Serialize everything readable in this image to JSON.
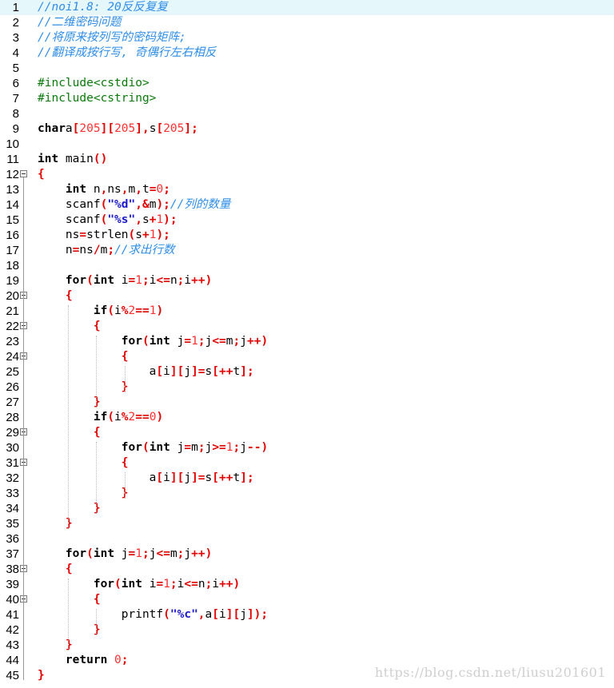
{
  "editor": {
    "lines": [
      {
        "n": "1",
        "active": true,
        "segs": [
          [
            "cmt",
            "//noi1.8: 20反反复复"
          ]
        ]
      },
      {
        "n": "2",
        "segs": [
          [
            "cmt",
            "//二维密码问题"
          ]
        ]
      },
      {
        "n": "3",
        "segs": [
          [
            "cmt",
            "//将原来按列写的密码矩阵;"
          ]
        ]
      },
      {
        "n": "4",
        "segs": [
          [
            "cmt",
            "//翻译成按行写, 奇偶行左右相反"
          ]
        ]
      },
      {
        "n": "5",
        "segs": []
      },
      {
        "n": "6",
        "segs": [
          [
            "pp",
            "#include<cstdio>"
          ]
        ]
      },
      {
        "n": "7",
        "segs": [
          [
            "pp",
            "#include<cstring>"
          ]
        ]
      },
      {
        "n": "8",
        "segs": []
      },
      {
        "n": "9",
        "segs": [
          [
            "kw",
            "char"
          ],
          [
            "",
            "a"
          ],
          [
            "op",
            "["
          ],
          [
            "num",
            "205"
          ],
          [
            "op",
            "]["
          ],
          [
            "num",
            "205"
          ],
          [
            "op",
            "],"
          ],
          [
            "",
            "s"
          ],
          [
            "op",
            "["
          ],
          [
            "num",
            "205"
          ],
          [
            "op",
            "];"
          ]
        ]
      },
      {
        "n": "10",
        "segs": []
      },
      {
        "n": "11",
        "segs": [
          [
            "kw",
            "int"
          ],
          [
            "",
            " main"
          ],
          [
            "op",
            "()"
          ]
        ]
      },
      {
        "n": "12",
        "fold": true,
        "segs": [
          [
            "op",
            "{"
          ]
        ]
      },
      {
        "n": "13",
        "segs": [
          [
            "",
            "    "
          ],
          [
            "kw",
            "int"
          ],
          [
            "",
            " n"
          ],
          [
            "op",
            ","
          ],
          [
            "",
            "ns"
          ],
          [
            "op",
            ","
          ],
          [
            "",
            "m"
          ],
          [
            "op",
            ","
          ],
          [
            "",
            "t"
          ],
          [
            "op",
            "="
          ],
          [
            "num",
            "0"
          ],
          [
            "op",
            ";"
          ]
        ]
      },
      {
        "n": "14",
        "segs": [
          [
            "",
            "    scanf"
          ],
          [
            "op",
            "("
          ],
          [
            "str",
            "\"%d\""
          ],
          [
            "op",
            ",&"
          ],
          [
            "",
            "m"
          ],
          [
            "op",
            ");"
          ],
          [
            "cmt",
            "//列的数量"
          ]
        ]
      },
      {
        "n": "15",
        "segs": [
          [
            "",
            "    scanf"
          ],
          [
            "op",
            "("
          ],
          [
            "str",
            "\"%s\""
          ],
          [
            "op",
            ","
          ],
          [
            "",
            "s"
          ],
          [
            "op",
            "+"
          ],
          [
            "num",
            "1"
          ],
          [
            "op",
            ");"
          ]
        ]
      },
      {
        "n": "16",
        "segs": [
          [
            "",
            "    ns"
          ],
          [
            "op",
            "="
          ],
          [
            "",
            "strlen"
          ],
          [
            "op",
            "("
          ],
          [
            "",
            "s"
          ],
          [
            "op",
            "+"
          ],
          [
            "num",
            "1"
          ],
          [
            "op",
            ");"
          ]
        ]
      },
      {
        "n": "17",
        "segs": [
          [
            "",
            "    n"
          ],
          [
            "op",
            "="
          ],
          [
            "",
            "ns"
          ],
          [
            "op",
            "/"
          ],
          [
            "",
            "m"
          ],
          [
            "op",
            ";"
          ],
          [
            "cmt",
            "//求出行数"
          ]
        ]
      },
      {
        "n": "18",
        "segs": []
      },
      {
        "n": "19",
        "segs": [
          [
            "",
            "    "
          ],
          [
            "kw",
            "for"
          ],
          [
            "op",
            "("
          ],
          [
            "kw",
            "int"
          ],
          [
            "",
            " i"
          ],
          [
            "op",
            "="
          ],
          [
            "num",
            "1"
          ],
          [
            "op",
            ";"
          ],
          [
            "",
            "i"
          ],
          [
            "op",
            "<="
          ],
          [
            "",
            "n"
          ],
          [
            "op",
            ";"
          ],
          [
            "",
            "i"
          ],
          [
            "op",
            "++)"
          ]
        ]
      },
      {
        "n": "20",
        "fold": true,
        "segs": [
          [
            "",
            "    "
          ],
          [
            "op",
            "{"
          ]
        ]
      },
      {
        "n": "21",
        "segs": [
          [
            "",
            "        "
          ],
          [
            "kw",
            "if"
          ],
          [
            "op",
            "("
          ],
          [
            "",
            "i"
          ],
          [
            "op",
            "%"
          ],
          [
            "num",
            "2"
          ],
          [
            "op",
            "=="
          ],
          [
            "num",
            "1"
          ],
          [
            "op",
            ")"
          ]
        ]
      },
      {
        "n": "22",
        "fold": true,
        "segs": [
          [
            "",
            "        "
          ],
          [
            "op",
            "{"
          ]
        ]
      },
      {
        "n": "23",
        "segs": [
          [
            "",
            "            "
          ],
          [
            "kw",
            "for"
          ],
          [
            "op",
            "("
          ],
          [
            "kw",
            "int"
          ],
          [
            "",
            " j"
          ],
          [
            "op",
            "="
          ],
          [
            "num",
            "1"
          ],
          [
            "op",
            ";"
          ],
          [
            "",
            "j"
          ],
          [
            "op",
            "<="
          ],
          [
            "",
            "m"
          ],
          [
            "op",
            ";"
          ],
          [
            "",
            "j"
          ],
          [
            "op",
            "++)"
          ]
        ]
      },
      {
        "n": "24",
        "fold": true,
        "segs": [
          [
            "",
            "            "
          ],
          [
            "op",
            "{"
          ]
        ]
      },
      {
        "n": "25",
        "segs": [
          [
            "",
            "                a"
          ],
          [
            "op",
            "["
          ],
          [
            "",
            "i"
          ],
          [
            "op",
            "]["
          ],
          [
            "",
            "j"
          ],
          [
            "op",
            "]="
          ],
          [
            "",
            "s"
          ],
          [
            "op",
            "[++"
          ],
          [
            "",
            "t"
          ],
          [
            "op",
            "];"
          ]
        ]
      },
      {
        "n": "26",
        "segs": [
          [
            "",
            "            "
          ],
          [
            "op",
            "}"
          ]
        ]
      },
      {
        "n": "27",
        "segs": [
          [
            "",
            "        "
          ],
          [
            "op",
            "}"
          ]
        ]
      },
      {
        "n": "28",
        "segs": [
          [
            "",
            "        "
          ],
          [
            "kw",
            "if"
          ],
          [
            "op",
            "("
          ],
          [
            "",
            "i"
          ],
          [
            "op",
            "%"
          ],
          [
            "num",
            "2"
          ],
          [
            "op",
            "=="
          ],
          [
            "num",
            "0"
          ],
          [
            "op",
            ")"
          ]
        ]
      },
      {
        "n": "29",
        "fold": true,
        "segs": [
          [
            "",
            "        "
          ],
          [
            "op",
            "{"
          ]
        ]
      },
      {
        "n": "30",
        "segs": [
          [
            "",
            "            "
          ],
          [
            "kw",
            "for"
          ],
          [
            "op",
            "("
          ],
          [
            "kw",
            "int"
          ],
          [
            "",
            " j"
          ],
          [
            "op",
            "="
          ],
          [
            "",
            "m"
          ],
          [
            "op",
            ";"
          ],
          [
            "",
            "j"
          ],
          [
            "op",
            ">="
          ],
          [
            "num",
            "1"
          ],
          [
            "op",
            ";"
          ],
          [
            "",
            "j"
          ],
          [
            "op",
            "--)"
          ]
        ]
      },
      {
        "n": "31",
        "fold": true,
        "segs": [
          [
            "",
            "            "
          ],
          [
            "op",
            "{"
          ]
        ]
      },
      {
        "n": "32",
        "segs": [
          [
            "",
            "                a"
          ],
          [
            "op",
            "["
          ],
          [
            "",
            "i"
          ],
          [
            "op",
            "]["
          ],
          [
            "",
            "j"
          ],
          [
            "op",
            "]="
          ],
          [
            "",
            "s"
          ],
          [
            "op",
            "[++"
          ],
          [
            "",
            "t"
          ],
          [
            "op",
            "];"
          ]
        ]
      },
      {
        "n": "33",
        "segs": [
          [
            "",
            "            "
          ],
          [
            "op",
            "}"
          ]
        ]
      },
      {
        "n": "34",
        "segs": [
          [
            "",
            "        "
          ],
          [
            "op",
            "}"
          ]
        ]
      },
      {
        "n": "35",
        "segs": [
          [
            "",
            "    "
          ],
          [
            "op",
            "}"
          ]
        ]
      },
      {
        "n": "36",
        "segs": []
      },
      {
        "n": "37",
        "segs": [
          [
            "",
            "    "
          ],
          [
            "kw",
            "for"
          ],
          [
            "op",
            "("
          ],
          [
            "kw",
            "int"
          ],
          [
            "",
            " j"
          ],
          [
            "op",
            "="
          ],
          [
            "num",
            "1"
          ],
          [
            "op",
            ";"
          ],
          [
            "",
            "j"
          ],
          [
            "op",
            "<="
          ],
          [
            "",
            "m"
          ],
          [
            "op",
            ";"
          ],
          [
            "",
            "j"
          ],
          [
            "op",
            "++)"
          ]
        ]
      },
      {
        "n": "38",
        "fold": true,
        "segs": [
          [
            "",
            "    "
          ],
          [
            "op",
            "{"
          ]
        ]
      },
      {
        "n": "39",
        "segs": [
          [
            "",
            "        "
          ],
          [
            "kw",
            "for"
          ],
          [
            "op",
            "("
          ],
          [
            "kw",
            "int"
          ],
          [
            "",
            " i"
          ],
          [
            "op",
            "="
          ],
          [
            "num",
            "1"
          ],
          [
            "op",
            ";"
          ],
          [
            "",
            "i"
          ],
          [
            "op",
            "<="
          ],
          [
            "",
            "n"
          ],
          [
            "op",
            ";"
          ],
          [
            "",
            "i"
          ],
          [
            "op",
            "++)"
          ]
        ]
      },
      {
        "n": "40",
        "fold": true,
        "segs": [
          [
            "",
            "        "
          ],
          [
            "op",
            "{"
          ]
        ]
      },
      {
        "n": "41",
        "segs": [
          [
            "",
            "            printf"
          ],
          [
            "op",
            "("
          ],
          [
            "str",
            "\"%c\""
          ],
          [
            "op",
            ","
          ],
          [
            "",
            "a"
          ],
          [
            "op",
            "["
          ],
          [
            "",
            "i"
          ],
          [
            "op",
            "]["
          ],
          [
            "",
            "j"
          ],
          [
            "op",
            "]);"
          ]
        ]
      },
      {
        "n": "42",
        "segs": [
          [
            "",
            "        "
          ],
          [
            "op",
            "}"
          ]
        ]
      },
      {
        "n": "43",
        "segs": [
          [
            "",
            "    "
          ],
          [
            "op",
            "}"
          ]
        ]
      },
      {
        "n": "44",
        "segs": [
          [
            "",
            "    "
          ],
          [
            "kw",
            "return"
          ],
          [
            "",
            " "
          ],
          [
            "num",
            "0"
          ],
          [
            "op",
            ";"
          ]
        ]
      },
      {
        "n": "45",
        "segs": [
          [
            "op",
            "}"
          ]
        ]
      }
    ]
  },
  "watermark": "https://blog.csdn.net/liusu201601",
  "colors": {
    "keyword": "#000000",
    "number": "#ff3030",
    "operator": "#e00000",
    "string": "#1a1ac8",
    "comment": "#2e8de6",
    "preprocessor": "#0a7a0a",
    "active_line": "#e6f7fb"
  }
}
